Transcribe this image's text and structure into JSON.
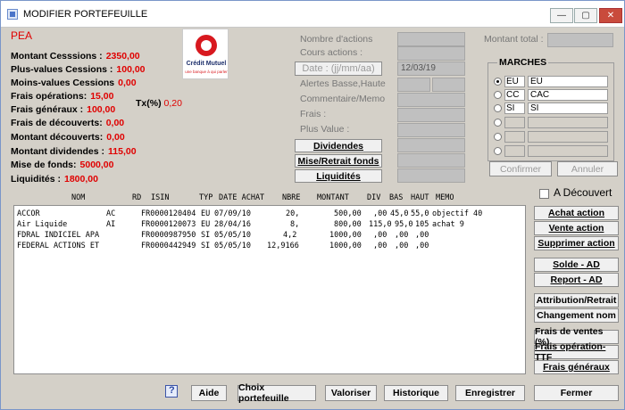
{
  "window": {
    "title": "MODIFIER PORTEFEUILLE",
    "minimize": "—",
    "maximize": "▢",
    "close": "✕"
  },
  "portfolio_type": "PEA",
  "stats": [
    {
      "label": "Montant Cesssions :",
      "value": "2350,00"
    },
    {
      "label": "Plus-values Cessions :",
      "value": "100,00"
    },
    {
      "label": "Moins-values Cessions",
      "value": "0,00"
    },
    {
      "label": "Frais opérations:",
      "value": "15,00"
    },
    {
      "label": "Frais généraux :",
      "value": "100,00"
    },
    {
      "label": "Frais de découverts:",
      "value": "0,00"
    },
    {
      "label": "Montant découverts:",
      "value": "0,00"
    },
    {
      "label": "Montant dividendes :",
      "value": "115,00"
    },
    {
      "label": "Mise de fonds:",
      "value": "5000,00"
    },
    {
      "label": "Liquidités :",
      "value": "1800,00"
    }
  ],
  "logo": {
    "line1": "Crédit Mutuel",
    "line2": "une banque à qui parler"
  },
  "tx": {
    "label": "Tx(%)",
    "value": "0,20"
  },
  "form": {
    "nombre_actions": "Nombre d'actions",
    "cours_actions": "Cours actions :",
    "date_button": "Date : (jj/mm/aa)",
    "date_value": "12/03/19",
    "alertes": "Alertes Basse,Haute",
    "commentaire": "Commentaire/Memo",
    "frais": "Frais :",
    "plus_value": "Plus Value :",
    "montant_total": "Montant total :"
  },
  "mid_buttons": {
    "dividendes": "Dividendes",
    "mise_retrait": "Mise/Retrait fonds",
    "liquidites": "Liquidités"
  },
  "marches": {
    "title": "MARCHES",
    "rows": [
      {
        "code": "EU",
        "name": "EU",
        "selected": true
      },
      {
        "code": "CC",
        "name": "CAC",
        "selected": false
      },
      {
        "code": "SI",
        "name": "SI",
        "selected": false
      },
      {
        "code": "",
        "name": "",
        "selected": false
      },
      {
        "code": "",
        "name": "",
        "selected": false
      },
      {
        "code": "",
        "name": "",
        "selected": false
      }
    ]
  },
  "confirm_buttons": {
    "confirmer": "Confirmer",
    "annuler": "Annuler"
  },
  "a_decouvert": "A Découvert",
  "columns": [
    "NOM",
    "RD",
    "ISIN",
    "TYP",
    "DATE ACHAT",
    "NBRE",
    "MONTANT",
    "DIV",
    "BAS",
    "HAUT",
    "MEMO"
  ],
  "rows": [
    {
      "nom": "ACCOR",
      "rd": "AC",
      "isin": "FR0000120404",
      "typ": "EU",
      "date": "07/09/10",
      "nbre": "20,",
      "montant": "500,00",
      "div": ",00",
      "bas": "45,0",
      "haut": "55,0",
      "memo": "objectif 40"
    },
    {
      "nom": "Air Liquide",
      "rd": "AI",
      "isin": "FR0000120073",
      "typ": "EU",
      "date": "28/04/16",
      "nbre": "8,",
      "montant": "800,00",
      "div": "115,0",
      "bas": "95,0",
      "haut": "105",
      "memo": "achat 9"
    },
    {
      "nom": "FDRAL INDICIEL APA",
      "rd": "",
      "isin": "FR0000987950",
      "typ": "SI",
      "date": "05/05/10",
      "nbre": "4,2",
      "montant": "1000,00",
      "div": ",00",
      "bas": ",00",
      "haut": ",00",
      "memo": ""
    },
    {
      "nom": "FEDERAL ACTIONS ET",
      "rd": "",
      "isin": "FR0000442949",
      "typ": "SI",
      "date": "05/05/10",
      "nbre": "12,9166",
      "montant": "1000,00",
      "div": ",00",
      "bas": ",00",
      "haut": ",00",
      "memo": ""
    }
  ],
  "right_buttons": {
    "achat_action": "Achat action",
    "vente_action": "Vente action",
    "supprimer_action": "Supprimer action",
    "solde_ad": "Solde - AD",
    "report_ad": "Report - AD",
    "attribution": "Attribution/Retrait",
    "changement_nom": "Changement nom",
    "frais_ventes": "Frais de ventes (%)",
    "frais_operation": "Frais opération-TTF",
    "frais_generaux": "Frais généraux"
  },
  "bottom_buttons": {
    "aide": "Aide",
    "choix": "Choix portefeuille",
    "valoriser": "Valoriser",
    "historique": "Historique",
    "enregistrer": "Enregistrer",
    "fermer": "Fermer"
  }
}
